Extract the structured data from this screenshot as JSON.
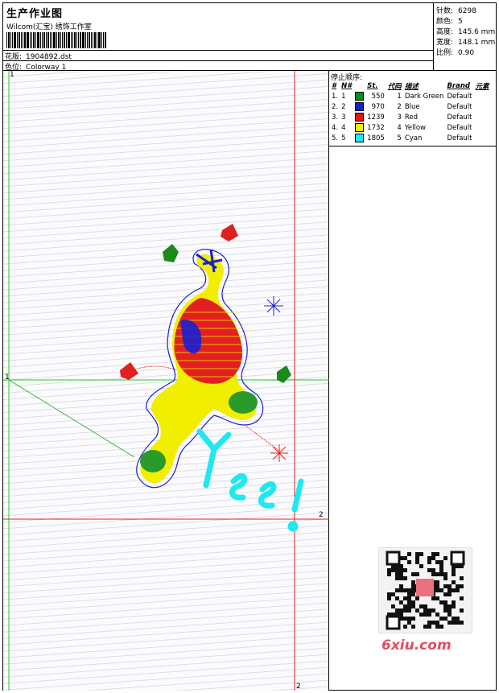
{
  "header": {
    "title": "生产作业图",
    "company": "Wilcom(汇宝) 绣饰工作室",
    "design_label": "花版:",
    "design_value": "1904892.dst",
    "colorway_label": "色位:",
    "colorway_value": "Colorway 1"
  },
  "stats": [
    {
      "label": "针数:",
      "value": "6298"
    },
    {
      "label": "颜色:",
      "value": "5"
    },
    {
      "label": "高度:",
      "value": "145.6 mm"
    },
    {
      "label": "宽度:",
      "value": "148.1 mm"
    },
    {
      "label": "比例:",
      "value": "0.90"
    }
  ],
  "stop_sequence": {
    "title": "停止顺序:",
    "columns": [
      "#",
      "N#",
      "St.",
      "代码",
      "描述",
      "Brand",
      "元素"
    ],
    "rows": [
      {
        "num": "1.",
        "n": "1",
        "color": "#0a8a1e",
        "st": "550",
        "code": "1",
        "desc": "Dark Green",
        "brand": "Default"
      },
      {
        "num": "2.",
        "n": "2",
        "color": "#1020d0",
        "st": "970",
        "code": "2",
        "desc": "Blue",
        "brand": "Default"
      },
      {
        "num": "3.",
        "n": "3",
        "color": "#e01818",
        "st": "1239",
        "code": "3",
        "desc": "Red",
        "brand": "Default"
      },
      {
        "num": "4.",
        "n": "4",
        "color": "#f4f000",
        "st": "1732",
        "code": "4",
        "desc": "Yellow",
        "brand": "Default"
      },
      {
        "num": "5.",
        "n": "5",
        "color": "#20e8f0",
        "st": "1805",
        "code": "5",
        "desc": "Cyan",
        "brand": "Default"
      }
    ]
  },
  "axis_marks": {
    "top_left": "1",
    "left_mid": "1",
    "right_mid": "2",
    "bottom": "2"
  },
  "watermark": {
    "site": "6xiu.com"
  },
  "colors": {
    "guide_green": "#22cc22",
    "guide_red": "#e02020"
  }
}
